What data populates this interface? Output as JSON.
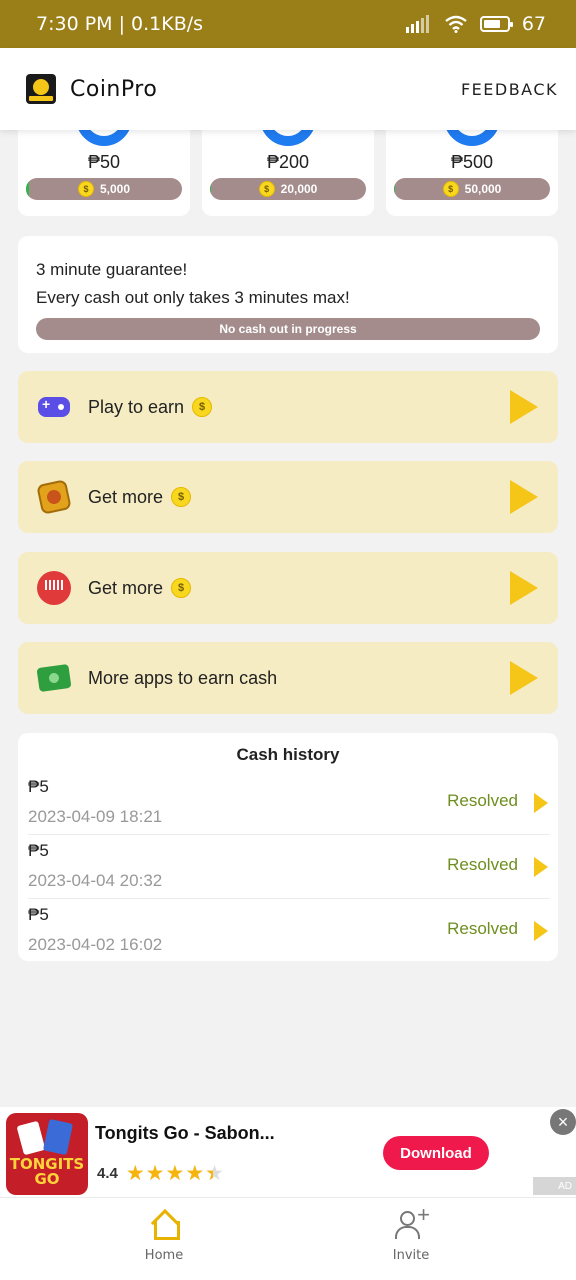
{
  "status_bar": {
    "time_speed": "7:30 PM | 0.1KB/s",
    "battery": "67"
  },
  "header": {
    "title": "CoinPro",
    "feedback": "FEEDBACK"
  },
  "tiers": [
    {
      "amount": "₱50",
      "coins": "5,000",
      "progress": 0.02
    },
    {
      "amount": "₱200",
      "coins": "20,000",
      "progress": 0.005
    },
    {
      "amount": "₱500",
      "coins": "50,000",
      "progress": 0.002
    }
  ],
  "guarantee": {
    "line1": "3 minute guarantee!",
    "line2": "Every cash out only takes 3 minutes max!",
    "status": "No cash out in progress"
  },
  "actions": [
    {
      "label": "Play to earn",
      "icon": "gamepad-icon",
      "coin": true
    },
    {
      "label": "Get more",
      "icon": "coin-box-icon",
      "coin": true
    },
    {
      "label": "Get more",
      "icon": "podcast-icon",
      "coin": true
    },
    {
      "label": "More apps to earn cash",
      "icon": "cash-icon",
      "coin": false
    }
  ],
  "history": {
    "title": "Cash history",
    "rows": [
      {
        "amount": "₱5",
        "date": "2023-04-09 18:21",
        "status": "Resolved"
      },
      {
        "amount": "₱5",
        "date": "2023-04-04 20:32",
        "status": "Resolved"
      },
      {
        "amount": "₱5",
        "date": "2023-04-02 16:02",
        "status": "Resolved"
      }
    ]
  },
  "ad": {
    "name": "Tongits Go - Sabon...",
    "rating": "4.4",
    "rating_fraction": 0.88,
    "download": "Download",
    "thumb_text": "TONGITS GO"
  },
  "nav": {
    "home": "Home",
    "invite": "Invite"
  },
  "colors": {
    "status_bar": "#9a7f18",
    "accent_yellow": "#f5c518",
    "action_card_bg": "#f6ecc4",
    "progress_track": "#a48c8c",
    "resolved_green": "#6e8e1e",
    "download_red": "#f0194c"
  },
  "coin_symbol": "$",
  "close_glyph": "×",
  "ad_badge_text": "AD"
}
